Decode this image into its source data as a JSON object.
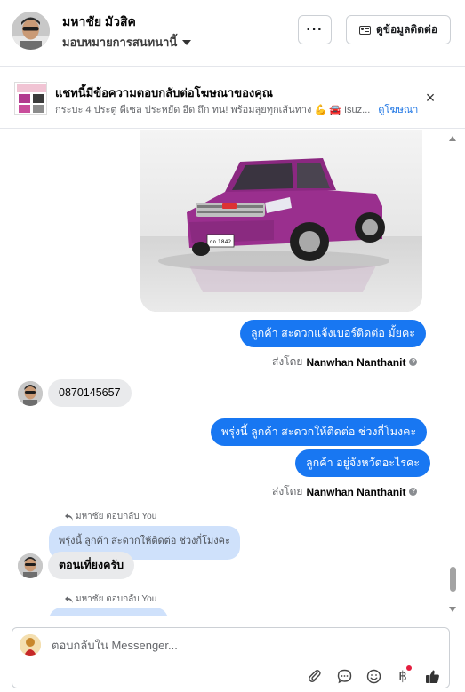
{
  "header": {
    "name": "มหาชัย มัวสิค",
    "assignee": "มอบหมายการสนทนานี้",
    "more_label": "···",
    "contact_button": "ดูข้อมูลติดต่อ"
  },
  "banner": {
    "title": "แชทนี้มีข้อความตอบกลับต่อโฆษณาของคุณ",
    "subtitle": "กระบะ 4 ประตู ดีเซล ประหยัด อึด ถึก ทน! พร้อมลุยทุกเส้นทาง 💪 🚘 Isuz...",
    "link": "ดูโฆษณา",
    "close_label": "×"
  },
  "messages": {
    "out1": "ลูกค้า สะดวกแจ้งเบอร์ติดต่อ มั้ยคะ",
    "sent_by_prefix": "ส่งโดย",
    "sender": "Nanwhan Nanthanit",
    "in1": "0870145657",
    "out2": "พรุ่งนี้ ลูกค้า สะดวกให้ติดต่อ ช่วงกี่โมงคะ",
    "out3": "ลูกค้า อยู่จังหวัดอะไรคะ",
    "reply_label": "มหาชัย ตอบกลับ You",
    "quoted1": "พรุ่งนี้ ลูกค้า สะดวกให้ติดต่อ ช่วงกี่โมงคะ",
    "in2": "ตอนเที่ยงครับ",
    "info_glyph": "?"
  },
  "photo": {
    "plate": "กถ 1842"
  },
  "composer": {
    "placeholder": "ตอบกลับใน Messenger...",
    "tools": [
      "paperclip-icon",
      "comment-icon",
      "emoji-icon",
      "baht-icon",
      "thumbs-up-icon"
    ],
    "baht_glyph": "฿"
  },
  "colors": {
    "accent": "#1877f2",
    "incoming_bubble": "#e9eaec",
    "quoted_bubble": "#cfe1fb",
    "car_body": "#9a2f8e"
  }
}
